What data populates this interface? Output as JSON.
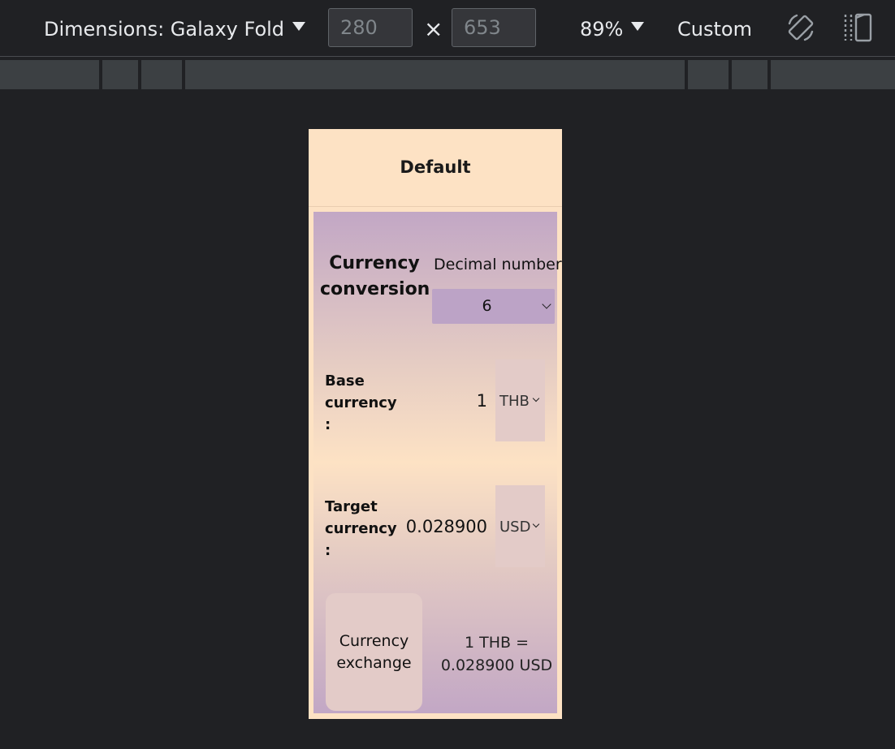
{
  "toolbar": {
    "dimensions_label": "Dimensions: Galaxy Fold",
    "width_value": "280",
    "height_value": "653",
    "times": "×",
    "zoom_label": "89%",
    "throttle_label": "Custom",
    "rotate_icon": "rotate-icon",
    "dual_screen_icon": "dual-screen-icon"
  },
  "page": {
    "header_title": "Default",
    "conversion_title": "Currency conversion",
    "decimal_label": "Decimal number",
    "decimal_value": "6",
    "base": {
      "label": "Base currency :",
      "amount": "1",
      "currency": "THB"
    },
    "target": {
      "label": "Target currency :",
      "amount": "0.028900",
      "currency": "USD"
    },
    "exchange_button": {
      "line1": "Currency",
      "line2": "exchange"
    },
    "result": {
      "line1": "1 THB =",
      "line2": "0.028900 USD"
    }
  },
  "colors": {
    "devtools_bg": "#202124",
    "page_peach": "#fde2c4",
    "page_mauve": "#c2a7c5",
    "select_bg": "#bca3c6"
  }
}
